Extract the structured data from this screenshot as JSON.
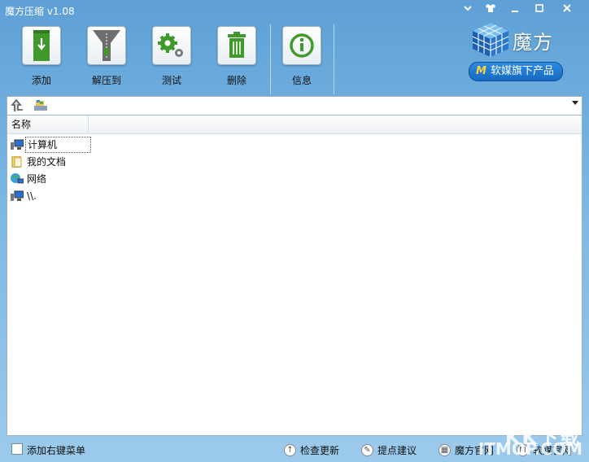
{
  "window": {
    "title": "魔方压缩 v1.08",
    "controls": {
      "minimize": "▁",
      "skin": "👕",
      "options": "▁",
      "maximize": "□",
      "close": "✕"
    }
  },
  "toolbar": {
    "buttons": [
      {
        "label": "添加",
        "icon": "add-icon"
      },
      {
        "label": "解压到",
        "icon": "extract-zipper-icon"
      },
      {
        "label": "测试",
        "icon": "gears-icon"
      },
      {
        "label": "删除",
        "icon": "trash-icon"
      },
      {
        "label": "信息",
        "icon": "info-icon"
      }
    ]
  },
  "brand": {
    "name": "魔方",
    "badge": "软媒旗下产品",
    "badge_mark": "M"
  },
  "address": {
    "value": "",
    "up_icon": "up-folder-icon",
    "drive_icon": "drive-icon"
  },
  "list": {
    "column_name": "名称",
    "items": [
      {
        "label": "计算机",
        "icon": "computer-icon"
      },
      {
        "label": "我的文档",
        "icon": "documents-icon"
      },
      {
        "label": "网络",
        "icon": "network-icon"
      },
      {
        "label": "\\\\.",
        "icon": "computer-icon"
      }
    ]
  },
  "status": {
    "context_menu": "添加右键菜单",
    "check_update": "检查更新",
    "suggest": "提点建议",
    "mofang_site": "魔方官网",
    "ruanmei_site": "软媒官网"
  },
  "watermark": {
    "line1": "KK下载",
    "line2": "ITMOP.COM"
  },
  "colors": {
    "accent": "#2d8ae0",
    "icon_green": "#3f9a2b",
    "titlebar": "#5ea0d6"
  }
}
